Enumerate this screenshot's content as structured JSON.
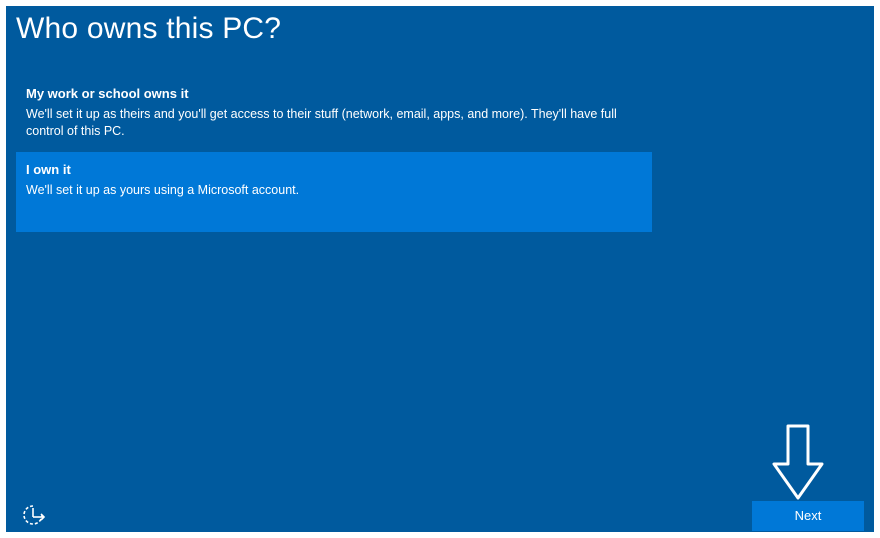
{
  "page": {
    "title": "Who owns this PC?"
  },
  "options": [
    {
      "title": "My work or school owns it",
      "description": "We'll set it up as theirs and you'll get access to their stuff (network, email, apps, and more). They'll have full control of this PC.",
      "selected": false
    },
    {
      "title": "I own it",
      "description": "We'll set it up as yours using a Microsoft account.",
      "selected": true
    }
  ],
  "footer": {
    "next_label": "Next",
    "accessibility_icon": "ease-of-access-icon",
    "annotation_icon": "down-arrow-icon"
  },
  "colors": {
    "background": "#005a9e",
    "selected_option": "#0078d7",
    "button": "#0078d7",
    "text": "#ffffff"
  }
}
